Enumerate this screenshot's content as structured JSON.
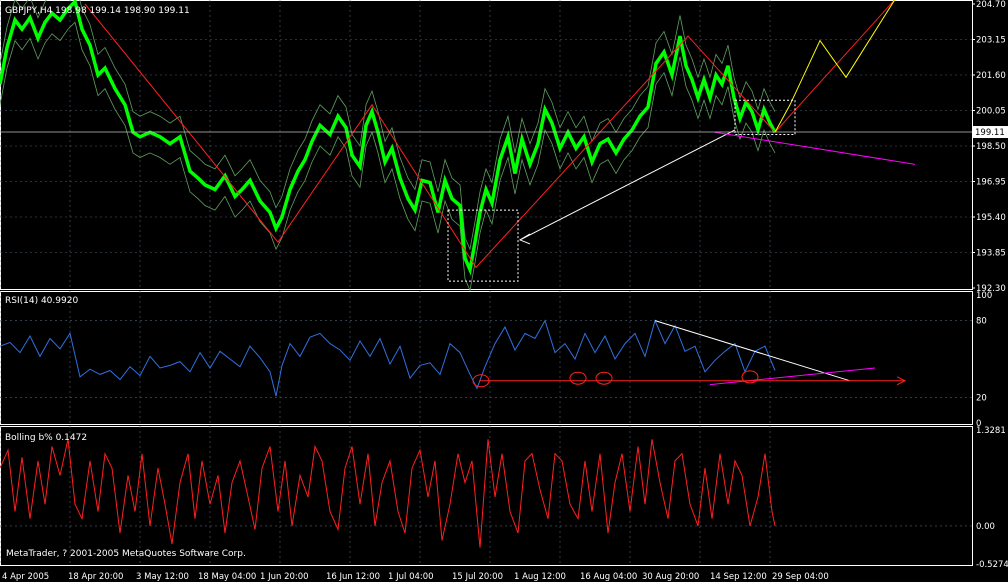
{
  "chart_data": [
    {
      "type": "line",
      "title": "GBPJPY,H4  198.98 199.14 198.90 199.11",
      "symbol": "GBPJPY",
      "timeframe": "H4",
      "ohlc": {
        "open": 198.98,
        "high": 199.14,
        "low": 198.9,
        "close": 199.11
      },
      "current_price_label": "199.11",
      "y_ticks": [
        "204.70",
        "203.15",
        "201.60",
        "200.05",
        "198.50",
        "196.95",
        "195.40",
        "193.85",
        "192.30"
      ],
      "ylim": [
        192.3,
        204.7
      ],
      "series": [
        {
          "name": "GBPJPY",
          "color": "#00ff00",
          "x": [
            0,
            7,
            15,
            22,
            30,
            38,
            45,
            52,
            60,
            68,
            75,
            82,
            90,
            98,
            105,
            115,
            125,
            133,
            140,
            150,
            160,
            170,
            180,
            190,
            198,
            205,
            215,
            225,
            235,
            242,
            250,
            260,
            270,
            276,
            282,
            290,
            298,
            305,
            312,
            320,
            330,
            338,
            346,
            352,
            360,
            366,
            372,
            378,
            385,
            392,
            400,
            408,
            415,
            422,
            430,
            438,
            445,
            452,
            460,
            465,
            470,
            475,
            480,
            486,
            492,
            500,
            508,
            515,
            522,
            530,
            538,
            545,
            552,
            560,
            568,
            576,
            584,
            592,
            600,
            608,
            616,
            624,
            632,
            640,
            648,
            656,
            664,
            672,
            680,
            686,
            692,
            698,
            704,
            710,
            716,
            722,
            728,
            734,
            740,
            746,
            752,
            758,
            764,
            770,
            775
          ],
          "values": [
            201.2,
            202.8,
            204.0,
            203.6,
            204.1,
            203.2,
            203.9,
            204.3,
            204.0,
            204.5,
            204.8,
            203.6,
            202.9,
            201.6,
            201.9,
            201.0,
            200.3,
            199.1,
            198.9,
            199.1,
            198.9,
            198.6,
            198.9,
            197.4,
            197.1,
            196.8,
            196.6,
            197.2,
            196.3,
            196.6,
            197.0,
            196.1,
            195.6,
            194.9,
            195.4,
            196.6,
            197.4,
            197.9,
            198.7,
            199.4,
            199.0,
            199.8,
            199.3,
            198.1,
            197.6,
            199.4,
            200.0,
            199.1,
            197.8,
            198.4,
            197.1,
            196.2,
            195.7,
            197.0,
            196.9,
            195.6,
            197.0,
            196.2,
            195.9,
            193.6,
            193.1,
            194.3,
            195.6,
            196.6,
            196.0,
            197.9,
            198.9,
            197.3,
            198.8,
            197.7,
            198.6,
            200.1,
            199.5,
            198.4,
            199.1,
            198.4,
            198.9,
            197.8,
            198.6,
            198.8,
            198.2,
            198.8,
            199.2,
            199.8,
            200.2,
            202.1,
            202.6,
            201.6,
            203.3,
            202.0,
            201.4,
            200.6,
            201.4,
            200.6,
            201.6,
            201.2,
            202.0,
            200.6,
            199.7,
            200.4,
            200.0,
            199.2,
            200.1,
            199.5,
            199.1
          ]
        },
        {
          "name": "ZigZag",
          "color": "#ff2020",
          "x": [
            85,
            278,
            372,
            476,
            688,
            775,
            895
          ],
          "values": [
            204.7,
            194.3,
            200.3,
            193.2,
            203.3,
            199.1,
            204.9
          ]
        },
        {
          "name": "Forecast path",
          "color": "#ffff00",
          "x": [
            775,
            790,
            820,
            846,
            895
          ],
          "values": [
            199.1,
            200.3,
            203.1,
            201.5,
            204.9
          ]
        }
      ],
      "annotations": {
        "trend_arrow": {
          "from": [
            735,
            199.2
          ],
          "to": [
            520,
            194.4
          ],
          "color": "#ffffff"
        },
        "magenta_trendline": {
          "from": [
            715,
            199.1
          ],
          "to": [
            915,
            197.7
          ],
          "color": "#ff00ff"
        },
        "box_bottom": {
          "x": [
            448,
            518
          ],
          "y": [
            192.6,
            195.7
          ]
        },
        "box_top": {
          "x": [
            735,
            795
          ],
          "y": [
            199.0,
            200.5
          ]
        }
      },
      "x_ticks": [
        "4 Apr 2005",
        "18 Apr 20:00",
        "3 May 12:00",
        "18 May 04:00",
        "1 Jun 20:00",
        "16 Jun 12:00",
        "1 Jul 04:00",
        "15 Jul 20:00",
        "1 Aug 12:00",
        "16 Aug 04:00",
        "30 Aug 20:00",
        "14 Sep 12:00",
        "29 Sep 04:00"
      ]
    },
    {
      "type": "line",
      "title": "RSI(14) 40.9920",
      "y_ticks": [
        "100",
        "80",
        "20",
        "0"
      ],
      "ylim": [
        0,
        100
      ],
      "series": [
        {
          "name": "RSI(14)",
          "color": "#3070e0",
          "x": [
            0,
            10,
            20,
            30,
            40,
            50,
            60,
            70,
            80,
            90,
            100,
            110,
            120,
            130,
            140,
            150,
            160,
            170,
            180,
            190,
            200,
            210,
            220,
            230,
            240,
            250,
            260,
            270,
            276,
            282,
            290,
            300,
            310,
            320,
            330,
            340,
            350,
            360,
            370,
            380,
            390,
            400,
            410,
            420,
            430,
            440,
            450,
            460,
            470,
            477,
            485,
            495,
            505,
            515,
            525,
            535,
            545,
            555,
            565,
            575,
            585,
            595,
            605,
            615,
            625,
            635,
            645,
            655,
            665,
            675,
            685,
            695,
            705,
            715,
            725,
            735,
            745,
            755,
            765,
            775
          ],
          "values": [
            60,
            63,
            55,
            68,
            52,
            66,
            58,
            70,
            36,
            42,
            38,
            41,
            34,
            44,
            37,
            52,
            43,
            45,
            48,
            40,
            55,
            43,
            56,
            50,
            44,
            60,
            51,
            40,
            21,
            45,
            62,
            52,
            67,
            70,
            62,
            57,
            49,
            64,
            52,
            66,
            46,
            60,
            35,
            45,
            47,
            38,
            62,
            55,
            38,
            27,
            44,
            62,
            75,
            57,
            70,
            66,
            80,
            55,
            62,
            50,
            70,
            55,
            68,
            50,
            62,
            70,
            52,
            80,
            62,
            76,
            56,
            60,
            40,
            49,
            56,
            62,
            40,
            56,
            60,
            41
          ]
        },
        {
          "name": "Resistance line",
          "color": "#ffffff",
          "x": [
            655,
            850
          ],
          "values": [
            80,
            33
          ]
        },
        {
          "name": "Support line",
          "color": "#ff00ff",
          "x": [
            710,
            875
          ],
          "values": [
            30,
            43
          ]
        },
        {
          "name": "Horizontal support",
          "color": "#ff2020",
          "x": [
            480,
            905
          ],
          "values": [
            33,
            33
          ]
        }
      ],
      "circles": [
        {
          "x": 481,
          "y": 33
        },
        {
          "x": 578,
          "y": 35
        },
        {
          "x": 604,
          "y": 35
        },
        {
          "x": 750,
          "y": 36
        }
      ]
    },
    {
      "type": "line",
      "title": "Bolling b%  0.1472",
      "y_ticks": [
        "1.3281",
        "0.00",
        "-0.5274"
      ],
      "ylim": [
        -0.5274,
        1.3281
      ],
      "series": [
        {
          "name": "Bollinger %b",
          "color": "#ff2020",
          "x": [
            0,
            8,
            15,
            22,
            30,
            38,
            45,
            52,
            60,
            68,
            75,
            82,
            90,
            98,
            105,
            112,
            120,
            128,
            135,
            142,
            150,
            158,
            165,
            172,
            180,
            188,
            195,
            202,
            210,
            218,
            225,
            232,
            240,
            248,
            255,
            262,
            270,
            278,
            285,
            292,
            300,
            308,
            315,
            322,
            330,
            338,
            345,
            352,
            360,
            368,
            375,
            382,
            390,
            398,
            405,
            412,
            420,
            428,
            435,
            442,
            450,
            458,
            465,
            472,
            480,
            488,
            495,
            502,
            510,
            518,
            525,
            532,
            540,
            548,
            555,
            562,
            570,
            578,
            585,
            592,
            600,
            608,
            615,
            622,
            630,
            638,
            645,
            652,
            660,
            668,
            675,
            682,
            690,
            698,
            705,
            712,
            720,
            728,
            735,
            742,
            750,
            758,
            765,
            772,
            775
          ],
          "values": [
            0.8,
            1.05,
            0.2,
            0.95,
            0.1,
            0.9,
            0.3,
            1.1,
            0.7,
            1.2,
            0.3,
            0.1,
            0.9,
            0.2,
            1.0,
            0.8,
            -0.1,
            0.7,
            0.2,
            1.0,
            0.0,
            0.8,
            0.3,
            -0.25,
            0.6,
            1.0,
            0.1,
            0.9,
            0.3,
            0.7,
            -0.1,
            0.6,
            0.9,
            0.4,
            -0.05,
            0.8,
            1.1,
            0.2,
            0.9,
            0.0,
            0.7,
            0.4,
            1.1,
            0.9,
            0.2,
            -0.05,
            0.8,
            1.1,
            0.3,
            1.0,
            0.0,
            0.6,
            0.9,
            0.2,
            -0.1,
            0.8,
            1.05,
            0.4,
            0.9,
            -0.2,
            0.3,
            1.0,
            0.6,
            0.9,
            -0.3,
            1.2,
            0.4,
            1.0,
            0.2,
            -0.1,
            0.9,
            1.0,
            0.5,
            0.1,
            1.0,
            0.9,
            0.3,
            0.1,
            0.9,
            0.2,
            1.0,
            -0.1,
            0.6,
            1.0,
            0.2,
            1.1,
            0.3,
            1.2,
            0.6,
            0.1,
            0.9,
            1.0,
            0.3,
            0.0,
            0.8,
            0.1,
            1.0,
            0.3,
            0.9,
            0.7,
            0.0,
            0.4,
            1.0,
            0.2,
            0.0
          ]
        }
      ]
    }
  ],
  "copyright": "MetaTrader, ? 2001-2005 MetaQuotes Software Corp.",
  "colors": {
    "background": "#000000",
    "grid": "#506070",
    "axis_text": "#ffffff"
  }
}
